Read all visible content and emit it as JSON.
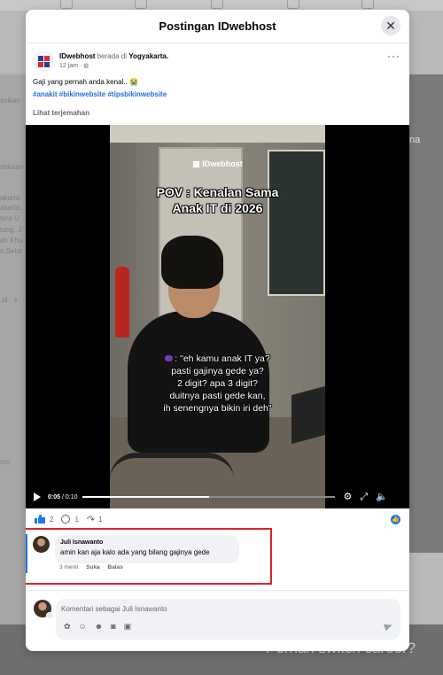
{
  "background": {
    "left_snippets": [
      "asikan",
      "dekaan",
      "akarta",
      "akarta,",
      "tera U",
      "tung, J",
      "ah Khu",
      "n Selat",
      ".id · s",
      "om"
    ],
    "right_snippets": [
      "na"
    ],
    "bottom_text": "Pernah switch career?"
  },
  "modal": {
    "title": "Postingan IDwebhost",
    "close_icon": "close-icon"
  },
  "post": {
    "author": "IDwebhost",
    "location_prefix": "berada di",
    "location": "Yogyakarta.",
    "time": "12 jam ·",
    "privacy_icon": "globe-icon",
    "text": "Gaji yang pernah anda kenal..",
    "emoji": "😭",
    "hashtags": "#anakit #bikinwebsite #tipsbikinwebsite",
    "see_translation": "Lihat terjemahan"
  },
  "video": {
    "watermark": "IDwebhost",
    "overlay_title_lines": [
      "POV : Kenalan Sama",
      "Anak IT di 2026"
    ],
    "caption_lines": [
      ": \"eh kamu anak IT ya?",
      "pasti gajinya gede ya?",
      "2 digit? apa 3 digit?",
      "duitnya pasti gede kan,",
      "ih senengnya bikin iri deh\""
    ],
    "current_time": "0:05",
    "duration": "/ 0:10",
    "progress": 0.5
  },
  "reactions": {
    "likes": "2",
    "comments": "1",
    "shares": "1"
  },
  "comment": {
    "author": "Juli Isnawanto",
    "text": "amin kan aja kalo ada yang bilang gajinya gede",
    "time": "3 menit",
    "like_label": "Suka",
    "reply_label": "Balas"
  },
  "composer": {
    "placeholder": "Komentari sebagai Juli Isnawanto",
    "tool_icons": [
      "sticker-icon",
      "avatar-icon",
      "emoji-icon",
      "camera-icon",
      "gif-icon"
    ]
  },
  "colors": {
    "accent": "#1877f2",
    "hashtag": "#216fdb",
    "highlight": "#d9232d"
  }
}
